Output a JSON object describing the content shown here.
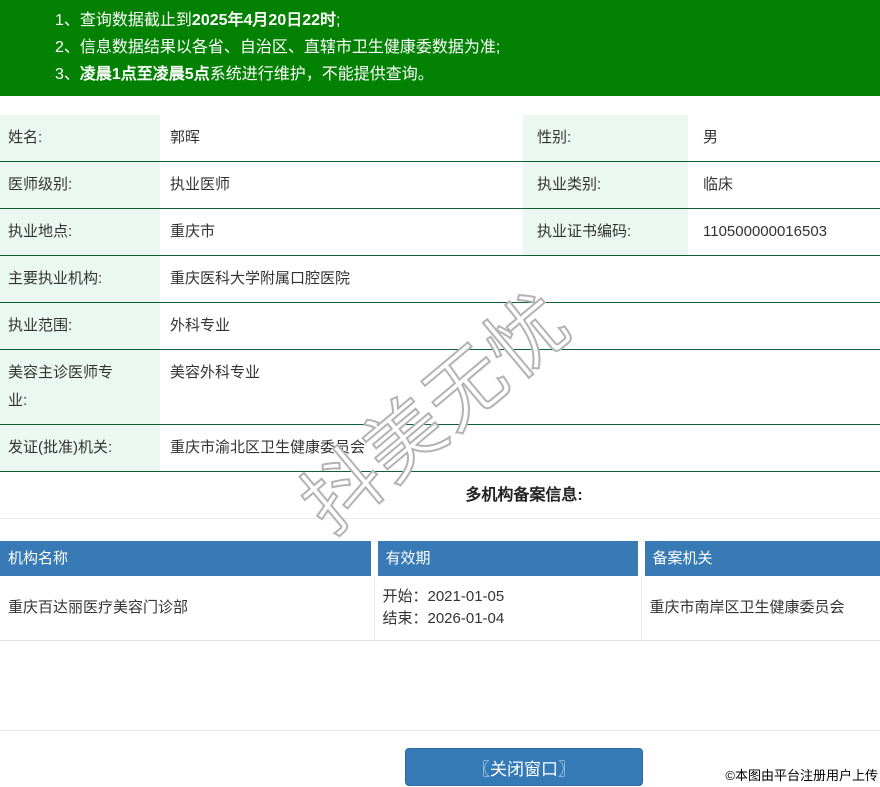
{
  "banner": {
    "items": [
      {
        "num": "1、",
        "pre": "查询数据截止到",
        "bold": "2025年4月20日22时",
        "post": ";"
      },
      {
        "num": "2、",
        "pre": "信息数据结果以各省、自治区、直辖市卫生健康委数据为准;",
        "bold": "",
        "post": ""
      },
      {
        "num": "3、",
        "pre": "",
        "bold": "凌晨1点至凌晨5点",
        "post": "系统进行维护，不能提供查询。"
      }
    ]
  },
  "info": {
    "rows2col": [
      {
        "l1": "姓名:",
        "v1": "郭晖",
        "l2": "性别:",
        "v2": "男"
      },
      {
        "l1": "医师级别:",
        "v1": "执业医师",
        "l2": "执业类别:",
        "v2": "临床"
      },
      {
        "l1": "执业地点:",
        "v1": "重庆市",
        "l2": "执业证书编码:",
        "v2": "110500000016503"
      }
    ],
    "rows1col": [
      {
        "label": "主要执业机构:",
        "value": "重庆医科大学附属口腔医院"
      },
      {
        "label": "执业范围:",
        "value": "外科专业"
      },
      {
        "label": "美容主诊医师专业:",
        "value": "美容外科专业"
      },
      {
        "label": "发证(批准)机关:",
        "value": "重庆市渝北区卫生健康委员会"
      }
    ]
  },
  "section": {
    "title": "多机构备案信息:"
  },
  "org_table": {
    "headers": [
      "机构名称",
      "有效期",
      "备案机关"
    ],
    "rows": [
      {
        "name": "重庆百达丽医疗美容门诊部",
        "valid_start": "开始：2021-01-05",
        "valid_end": "结束：2026-01-04",
        "authority": "重庆市南岸区卫生健康委员会"
      }
    ]
  },
  "footer": {
    "close_button": "〖关闭窗口〗",
    "attribution": "©本图由平台注册用户上传"
  },
  "watermark": {
    "text": "抖美无忧"
  },
  "colors": {
    "banner_green": "#028102",
    "row_border_green": "#0f5f3a",
    "label_bg": "#eaf8f1",
    "table_header_blue": "#377ab6",
    "button_blue": "#337ab7"
  }
}
